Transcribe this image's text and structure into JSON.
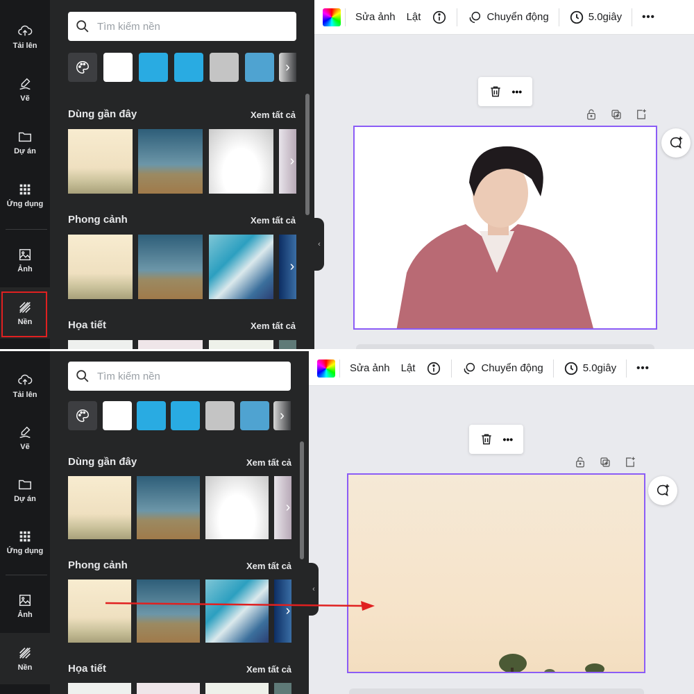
{
  "sidebar": {
    "items": [
      {
        "label": "Tải lên",
        "icon": "upload-icon"
      },
      {
        "label": "Vẽ",
        "icon": "draw-icon"
      },
      {
        "label": "Dự án",
        "icon": "folder-icon"
      },
      {
        "label": "Ứng dụng",
        "icon": "apps-icon"
      },
      {
        "label": "Ảnh",
        "icon": "image-icon"
      },
      {
        "label": "Nền",
        "icon": "background-icon"
      }
    ]
  },
  "panel": {
    "search_placeholder": "Tìm kiếm nền",
    "swatch_colors": [
      "#ffffff",
      "#29abe2",
      "#29abe2",
      "#c4c4c4",
      "#4fa3d1"
    ],
    "sections": [
      {
        "title": "Dùng gần đây",
        "see_all": "Xem tất cả"
      },
      {
        "title": "Phong cảnh",
        "see_all": "Xem tất cả"
      },
      {
        "title": "Họa tiết",
        "see_all": "Xem tất cả"
      }
    ]
  },
  "toolbar": {
    "edit_photo": "Sửa ảnh",
    "flip": "Lật",
    "animate": "Chuyển động",
    "duration": "5.0giây",
    "more": "•••"
  },
  "floatbar": {
    "more": "•••"
  },
  "colors": {
    "selection": "#8b5cf6",
    "highlight": "#e02020",
    "dark_bg": "#18191b",
    "panel_bg": "#252627"
  }
}
